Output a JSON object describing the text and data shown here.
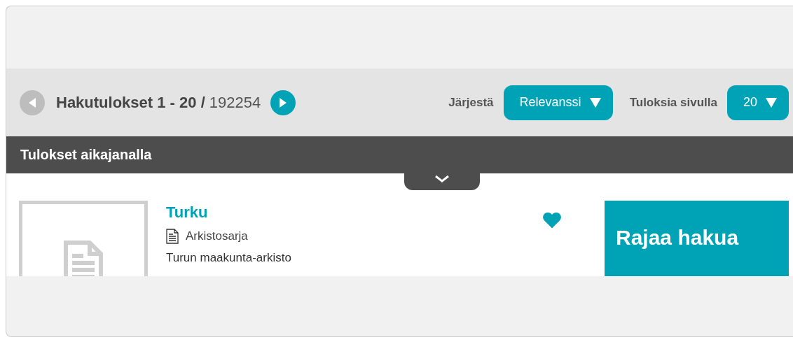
{
  "pager": {
    "prev": {
      "disabled": true
    },
    "summary": "**Hakutulokset 1 - 20 /** 192254",
    "next": {
      "disabled": false
    }
  },
  "sort": {
    "label": "Järjestä",
    "value": "Relevanssi"
  },
  "page_size": {
    "label": "Tuloksia sivulla",
    "value": "20"
  },
  "timeline": {
    "title": "Tulokset aikajanalla",
    "expanded": false
  },
  "results": [
    {
      "title": "Turku",
      "format": "Arkistosarja",
      "organisation": "Turun maakunta-arkisto",
      "favorited": true
    }
  ],
  "filter_panel": {
    "title": "Rajaa hakua"
  }
}
